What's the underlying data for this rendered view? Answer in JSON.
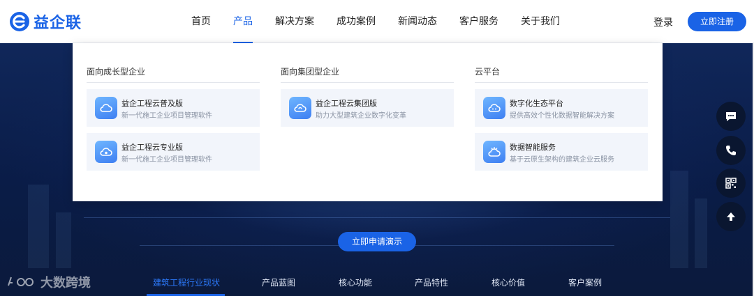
{
  "brand": {
    "name": "益企联",
    "accent": "#1a63e6"
  },
  "nav": {
    "items": [
      {
        "label": "首页",
        "active": false
      },
      {
        "label": "产品",
        "active": true
      },
      {
        "label": "解决方案",
        "active": false
      },
      {
        "label": "成功案例",
        "active": false
      },
      {
        "label": "新闻动态",
        "active": false
      },
      {
        "label": "客户服务",
        "active": false
      },
      {
        "label": "关于我们",
        "active": false
      }
    ],
    "login": "登录",
    "register": "立即注册"
  },
  "dropdown": {
    "columns": [
      {
        "title": "面向成长型企业",
        "cards": [
          {
            "title": "益企工程云普及版",
            "subtitle": "新一代施工企业项目管理软件",
            "icon": "cloud-icon"
          },
          {
            "title": "益企工程云专业版",
            "subtitle": "新一代施工企业项目管理软件",
            "icon": "cloud-gear-icon"
          }
        ]
      },
      {
        "title": "面向集团型企业",
        "cards": [
          {
            "title": "益企工程云集团版",
            "subtitle": "助力大型建筑企业数字化变革",
            "icon": "cloud-sync-icon"
          }
        ]
      },
      {
        "title": "云平台",
        "cards": [
          {
            "title": "数字化生态平台",
            "subtitle": "提供高效个性化数据智能解决方案",
            "icon": "cloud-network-icon"
          },
          {
            "title": "数据智能服务",
            "subtitle": "基于云原生架构的建筑企业云服务",
            "icon": "lightbulb-cloud-icon"
          }
        ]
      }
    ]
  },
  "hero": {
    "demo_button": "立即申请演示"
  },
  "tabs": {
    "items": [
      {
        "label": "建筑工程行业现状",
        "active": true
      },
      {
        "label": "产品蓝图",
        "active": false
      },
      {
        "label": "核心功能",
        "active": false
      },
      {
        "label": "产品特性",
        "active": false
      },
      {
        "label": "核心价值",
        "active": false
      },
      {
        "label": "客户案例",
        "active": false
      }
    ]
  },
  "watermark": {
    "text": "大数跨境"
  },
  "float_buttons": [
    "chat-icon",
    "phone-icon",
    "qrcode-icon",
    "arrow-up-icon"
  ]
}
